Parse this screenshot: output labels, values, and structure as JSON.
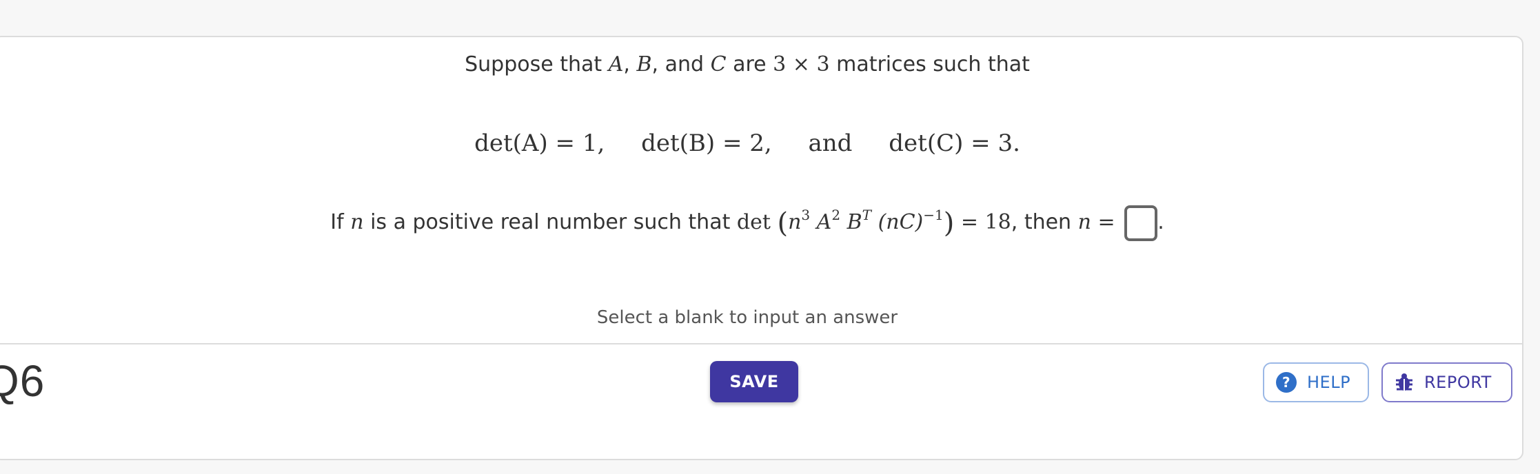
{
  "question": {
    "intro": {
      "prefix": "Suppose that",
      "A": "A",
      "comma1": ",",
      "B": "B",
      "and_text": ", and",
      "C": "C",
      "are_text": "are",
      "dim": "3 × 3",
      "suffix": "matrices such that"
    },
    "dets": {
      "d1": "det(A) = 1,",
      "d2": "det(B) = 2,",
      "and_word": "and",
      "d3": "det(C) = 3."
    },
    "condition": {
      "if_text": "If",
      "n1": "n",
      "mid_text": "is a positive real number such that",
      "det": "det",
      "n2": "n",
      "exp3": "3",
      "A": "A",
      "exp2": "2",
      "B": "B",
      "expT": "T",
      "nC": "(nC)",
      "expInv": "−1",
      "equals": "= 18",
      "then_text": ", then",
      "n3": "n",
      "eq2": "=",
      "period": "."
    }
  },
  "hint": "Select a blank to input an answer",
  "question_label": "Q6",
  "buttons": {
    "save": "SAVE",
    "help": "HELP",
    "report": "REPORT"
  },
  "colors": {
    "save_bg": "#3f37a1",
    "help_fg": "#2f6fc8",
    "report_fg": "#3f37a1"
  },
  "icons": {
    "help": "question-circle-icon",
    "report": "bug-icon"
  }
}
